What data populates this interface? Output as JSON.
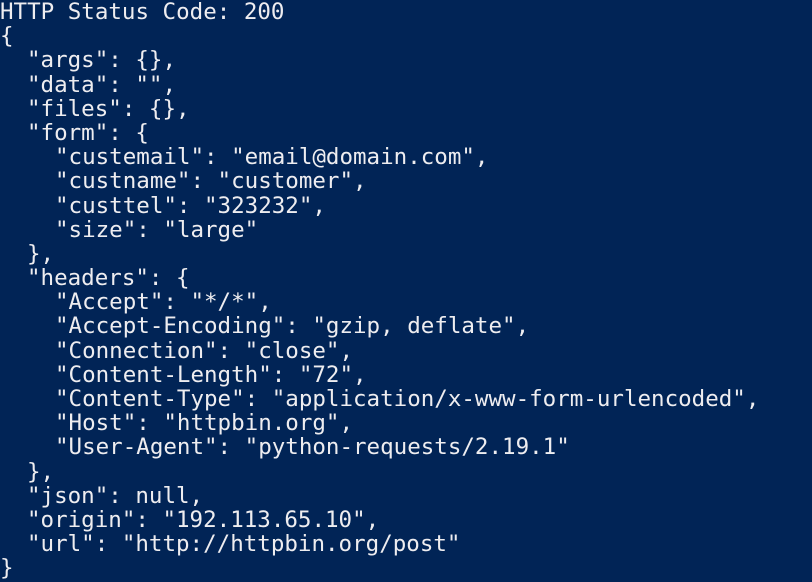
{
  "console": {
    "status_line": "HTTP Status Code: 200",
    "lines": [
      {
        "indent": 0,
        "text": "{"
      },
      {
        "indent": 1,
        "text": "\"args\": {},"
      },
      {
        "indent": 1,
        "text": "\"data\": \"\","
      },
      {
        "indent": 1,
        "text": "\"files\": {},"
      },
      {
        "indent": 1,
        "text": "\"form\": {"
      },
      {
        "indent": 2,
        "text": "\"custemail\": \"email@domain.com\","
      },
      {
        "indent": 2,
        "text": "\"custname\": \"customer\","
      },
      {
        "indent": 2,
        "text": "\"custtel\": \"323232\","
      },
      {
        "indent": 2,
        "text": "\"size\": \"large\""
      },
      {
        "indent": 1,
        "text": "},"
      },
      {
        "indent": 1,
        "text": "\"headers\": {"
      },
      {
        "indent": 2,
        "text": "\"Accept\": \"*/*\","
      },
      {
        "indent": 2,
        "text": "\"Accept-Encoding\": \"gzip, deflate\","
      },
      {
        "indent": 2,
        "text": "\"Connection\": \"close\","
      },
      {
        "indent": 2,
        "text": "\"Content-Length\": \"72\","
      },
      {
        "indent": 2,
        "text": "\"Content-Type\": \"application/x-www-form-urlencoded\","
      },
      {
        "indent": 2,
        "text": "\"Host\": \"httpbin.org\","
      },
      {
        "indent": 2,
        "text": "\"User-Agent\": \"python-requests/2.19.1\""
      },
      {
        "indent": 1,
        "text": "},"
      },
      {
        "indent": 1,
        "text": "\"json\": null,"
      },
      {
        "indent": 1,
        "text": "\"origin\": \"192.113.65.10\","
      },
      {
        "indent": 1,
        "text": "\"url\": \"http://httpbin.org/post\""
      },
      {
        "indent": 0,
        "text": "}"
      }
    ]
  },
  "colors": {
    "background": "#012456",
    "foreground": "#eeedf0"
  }
}
